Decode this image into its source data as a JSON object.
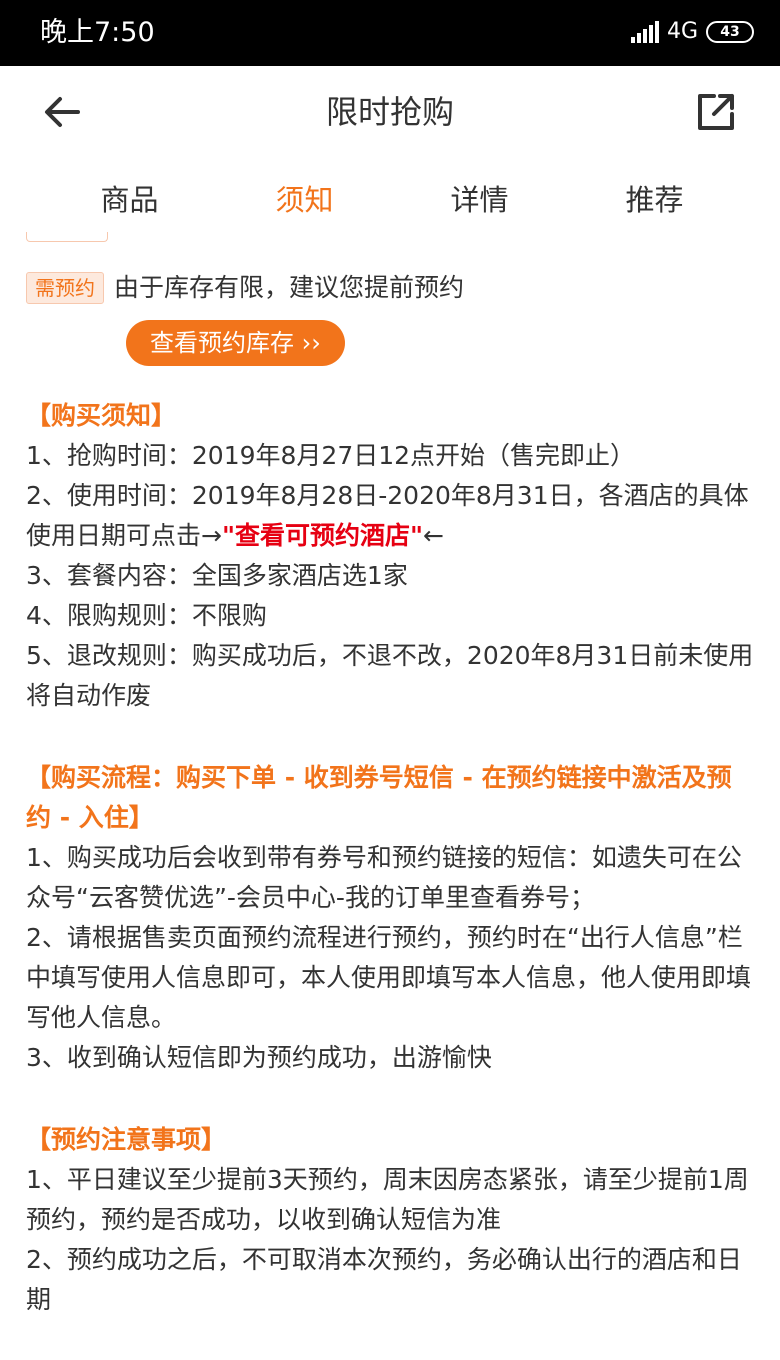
{
  "status": {
    "time": "晚上7:50",
    "network": "4G",
    "battery": "43"
  },
  "nav": {
    "title": "限时抢购"
  },
  "tabs": [
    {
      "label": "商品"
    },
    {
      "label": "须知"
    },
    {
      "label": "详情"
    },
    {
      "label": "推荐"
    }
  ],
  "reserve": {
    "badge": "需预约",
    "text": "由于库存有限，建议您提前预约",
    "button": "查看预约库存 ››"
  },
  "purchase_notes": {
    "title": "【购买须知】",
    "line1": "1、抢购时间：2019年8月27日12点开始（售完即止）",
    "line2_a": "2、使用时间：2019年8月28日-2020年8月31日，各酒店的具体使用日期可点击→",
    "line2_link": "\"查看可预约酒店\"",
    "line2_b": "←",
    "line3": "3、套餐内容：全国多家酒店选1家",
    "line4": "4、限购规则：不限购",
    "line5": "5、退改规则：购买成功后，不退不改，2020年8月31日前未使用将自动作废"
  },
  "process": {
    "title": "【购买流程：购买下单 - 收到券号短信 - 在预约链接中激活及预约 - 入住】",
    "line1": "1、购买成功后会收到带有券号和预约链接的短信：如遗失可在公众号“云客赞优选”-会员中心-我的订单里查看券号；",
    "line2": "2、请根据售卖页面预约流程进行预约，预约时在“出行人信息”栏中填写使用人信息即可，本人使用即填写本人信息，他人使用即填写他人信息。",
    "line3": "3、收到确认短信即为预约成功，出游愉快"
  },
  "booking_notes": {
    "title": "【预约注意事项】",
    "line1": "1、平日建议至少提前3天预约，周末因房态紧张，请至少提前1周预约，预约是否成功，以收到确认短信为准",
    "line2": "2、预约成功之后，不可取消本次预约，务必确认出行的酒店和日期"
  },
  "colors": {
    "accent": "#f2741b",
    "link_red": "#e60012",
    "status_bg": "#000000"
  },
  "icons": {
    "back": "arrow-left-icon",
    "share": "share-icon"
  }
}
